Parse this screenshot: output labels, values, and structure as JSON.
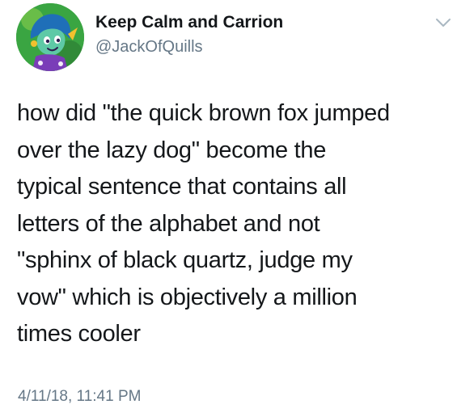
{
  "author": {
    "display_name": "Keep Calm and Carrion",
    "handle": "@JackOfQuills",
    "avatar_icon": "cartoon-character-avatar"
  },
  "tweet": {
    "text": "how did \"the quick brown fox jumped\nover the lazy dog\" become the\ntypical sentence that contains all\nletters of the alphabet and not\n\"sphinx of black quartz, judge my\nvow\" which is objectively a million\ntimes cooler",
    "timestamp": "4/11/18, 11:41 PM"
  },
  "menu": {
    "icon": "chevron-down-icon"
  },
  "colors": {
    "text": "#14171a",
    "secondary_text": "#657786",
    "avatar_bg": "#3aa542",
    "chevron": "#aab8c2"
  }
}
